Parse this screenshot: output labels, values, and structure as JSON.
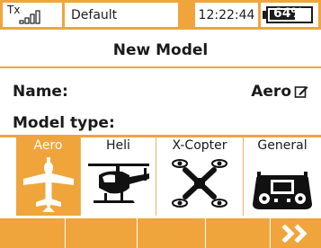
{
  "status": {
    "tx_label": "Tx",
    "signal_bars": 4,
    "model_name": "Default",
    "time": "12:22:44",
    "battery_text": "64%",
    "battery_level": 0.64
  },
  "page": {
    "title": "New Model"
  },
  "name_row": {
    "label": "Name:",
    "value": "Aero",
    "edit_icon": "pencil-edit-icon"
  },
  "model_type_row": {
    "label": "Model type:"
  },
  "model_types": [
    {
      "label": "Aero",
      "icon": "airplane-icon",
      "selected": true
    },
    {
      "label": "Heli",
      "icon": "helicopter-icon",
      "selected": false
    },
    {
      "label": "X-Copter",
      "icon": "quadcopter-icon",
      "selected": false
    },
    {
      "label": "General",
      "icon": "transmitter-icon",
      "selected": false
    }
  ],
  "bottom_bar": {
    "next_icon": "double-chevron-right-icon"
  },
  "colors": {
    "accent": "#f0a53c",
    "text": "#1a1a1a",
    "selected_text": "#ffffff"
  }
}
